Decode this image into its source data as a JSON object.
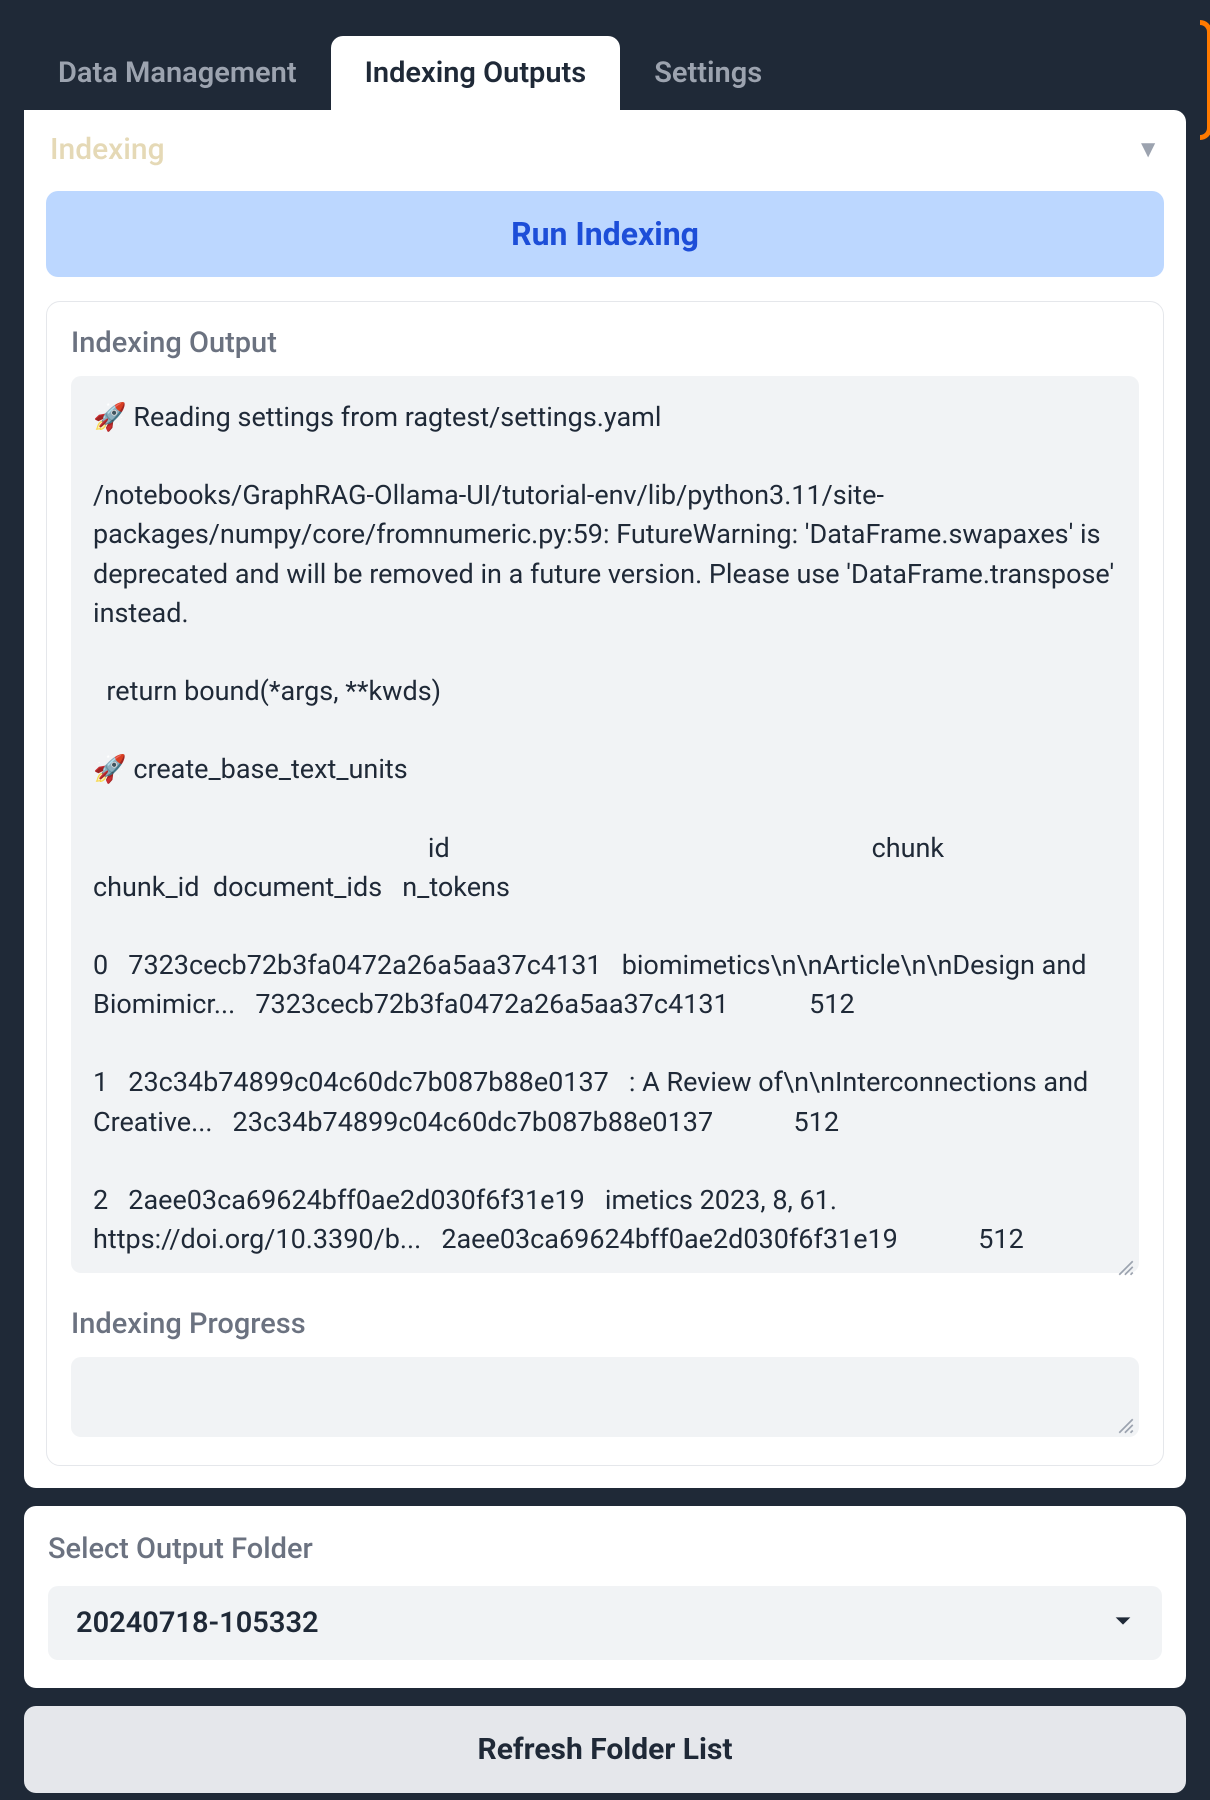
{
  "tabs": {
    "data_management": "Data Management",
    "indexing_outputs": "Indexing Outputs",
    "settings": "Settings",
    "active": "indexing_outputs"
  },
  "accordion": {
    "title": "Indexing"
  },
  "run_button": "Run Indexing",
  "output_section": {
    "label": "Indexing Output",
    "log": "🚀 Reading settings from ragtest/settings.yaml\n\n/notebooks/GraphRAG-Ollama-UI/tutorial-env/lib/python3.11/site-packages/numpy/core/fromnumeric.py:59: FutureWarning: 'DataFrame.swapaxes' is deprecated and will be removed in a future version. Please use 'DataFrame.transpose' instead.\n\n  return bound(*args, **kwds)\n\n🚀 create_base_text_units\n\n                                                  id                                                               chunk                          chunk_id  document_ids   n_tokens\n\n0   7323cecb72b3fa0472a26a5aa37c4131   biomimetics\\n\\nArticle\\n\\nDesign and Biomimicr...   7323cecb72b3fa0472a26a5aa37c4131            512\n\n1   23c34b74899c04c60dc7b087b88e0137   : A Review of\\n\\nInterconnections and Creative...   23c34b74899c04c60dc7b087b88e0137            512\n\n2   2aee03ca69624bff0ae2d030f6f31e19   imetics 2023, 8, 61. https://doi.org/10.3390/b...   2aee03ca69624bff0ae2d030f6f31e19            512"
  },
  "progress_section": {
    "label": "Indexing Progress",
    "value": ""
  },
  "folder_select": {
    "label": "Select Output Folder",
    "selected": "20240718-105332"
  },
  "refresh_button": "Refresh Folder List"
}
